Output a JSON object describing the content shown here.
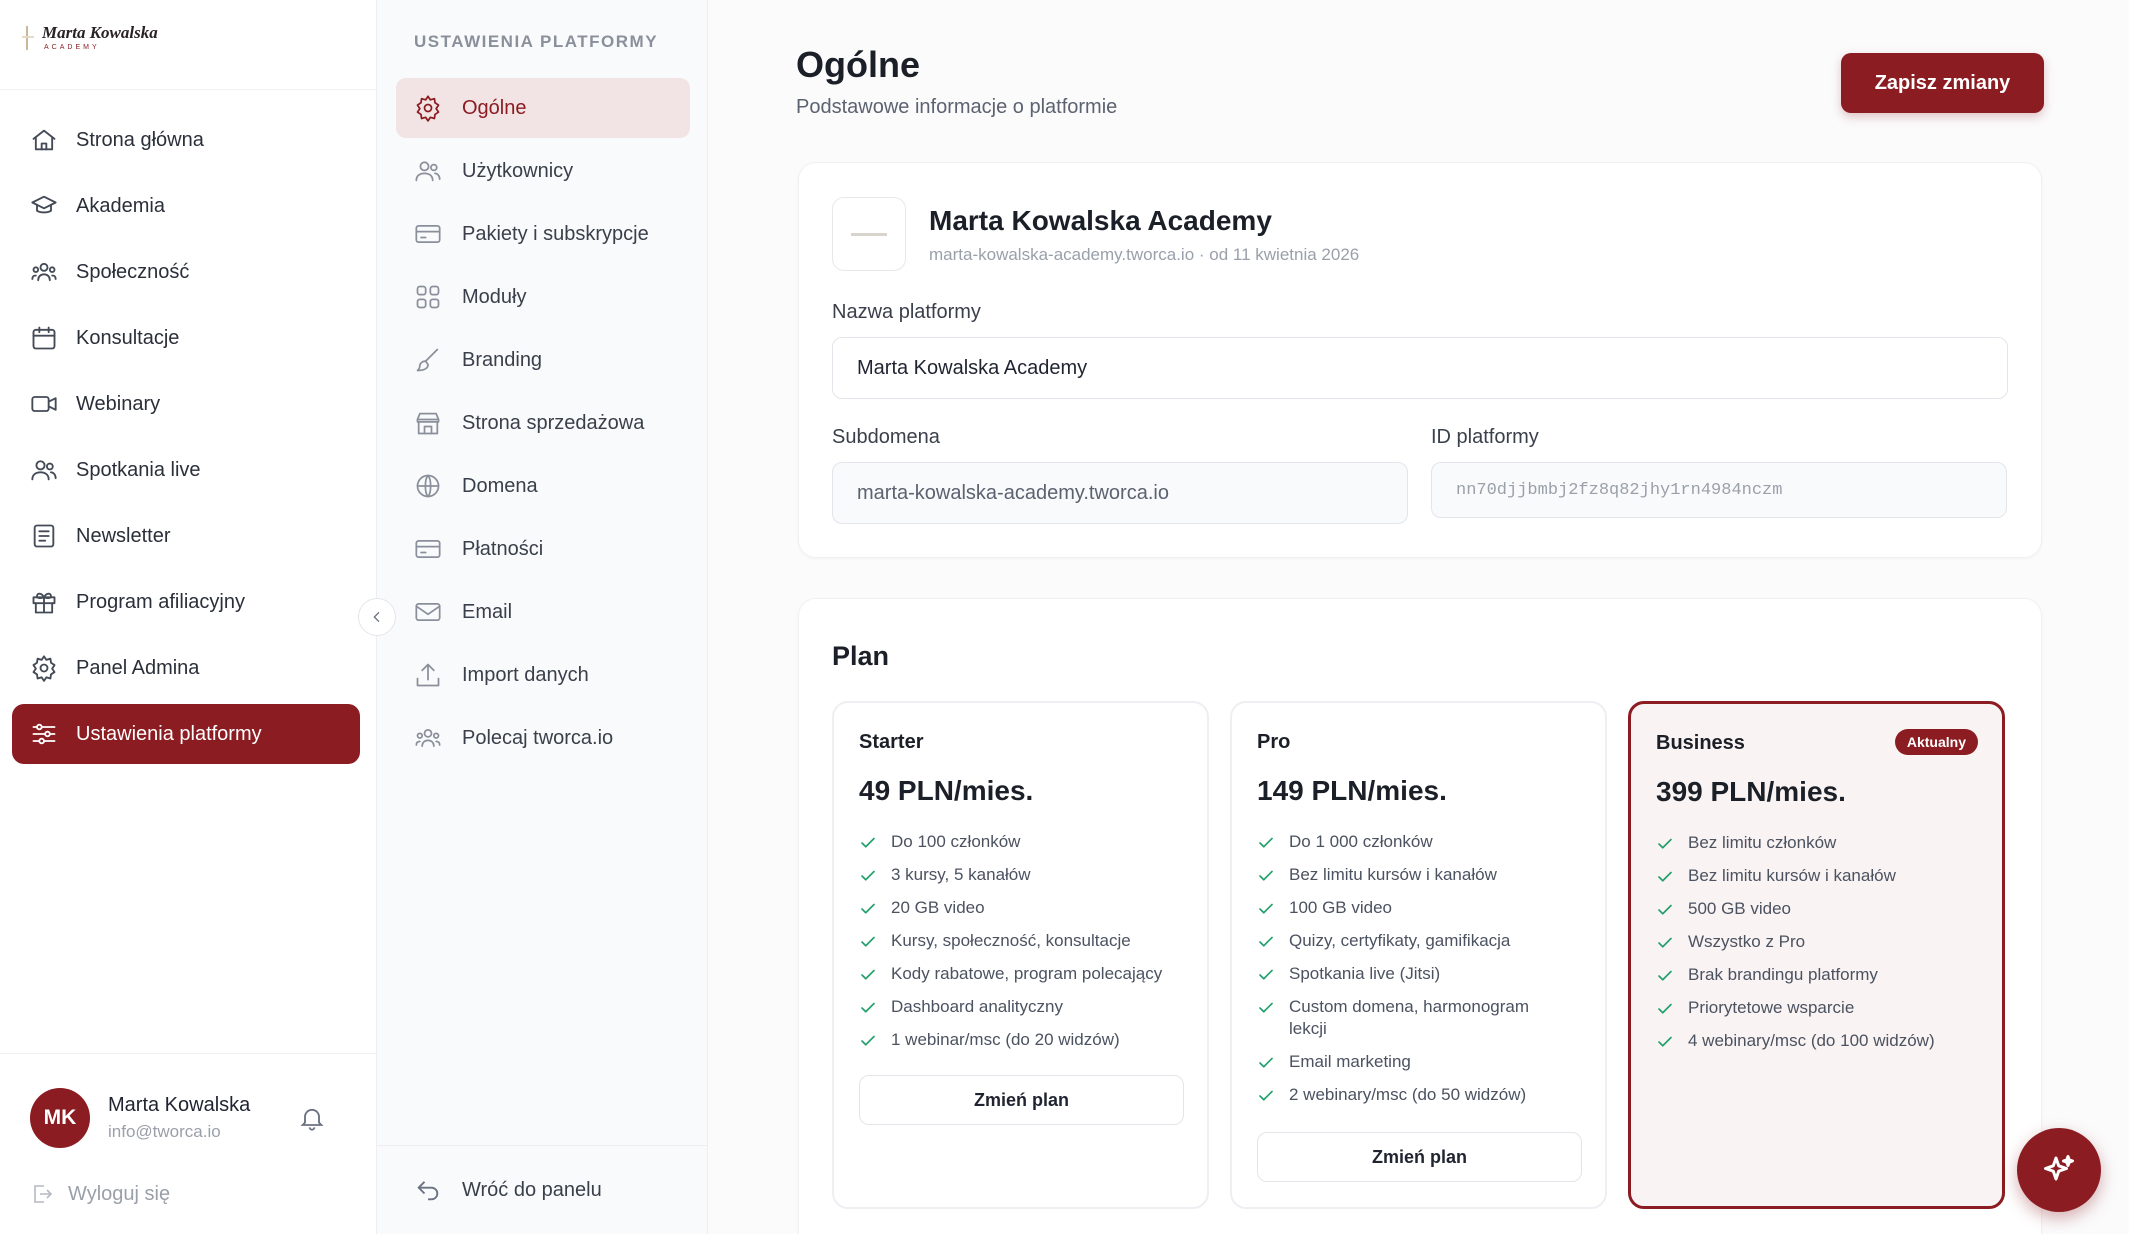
{
  "brand": {
    "name": "Marta Kowalska",
    "sub": "ACADEMY"
  },
  "sidebar": {
    "items": [
      {
        "label": "Strona główna",
        "icon": "home-icon"
      },
      {
        "label": "Akademia",
        "icon": "graduation-cap-icon"
      },
      {
        "label": "Społeczność",
        "icon": "community-icon"
      },
      {
        "label": "Konsultacje",
        "icon": "calendar-icon"
      },
      {
        "label": "Webinary",
        "icon": "video-icon"
      },
      {
        "label": "Spotkania live",
        "icon": "users-icon"
      },
      {
        "label": "Newsletter",
        "icon": "newsletter-icon"
      },
      {
        "label": "Program afiliacyjny",
        "icon": "gift-icon"
      },
      {
        "label": "Panel Admina",
        "icon": "gear-icon"
      },
      {
        "label": "Ustawienia platformy",
        "icon": "sliders-icon",
        "active": true
      }
    ]
  },
  "user": {
    "initials": "MK",
    "name": "Marta Kowalska",
    "email": "info@tworca.io",
    "logout": "Wyloguj się"
  },
  "settings_nav": {
    "title": "USTAWIENIA PLATFORMY",
    "items": [
      {
        "label": "Ogólne",
        "icon": "gear-icon",
        "active": true
      },
      {
        "label": "Użytkownicy",
        "icon": "users-icon"
      },
      {
        "label": "Pakiety i subskrypcje",
        "icon": "card-icon"
      },
      {
        "label": "Moduły",
        "icon": "grid-icon"
      },
      {
        "label": "Branding",
        "icon": "brush-icon"
      },
      {
        "label": "Strona sprzedażowa",
        "icon": "store-icon"
      },
      {
        "label": "Domena",
        "icon": "globe-icon"
      },
      {
        "label": "Płatności",
        "icon": "card-icon"
      },
      {
        "label": "Email",
        "icon": "mail-icon"
      },
      {
        "label": "Import danych",
        "icon": "upload-icon"
      },
      {
        "label": "Polecaj tworca.io",
        "icon": "community-icon"
      }
    ],
    "back": "Wróć do panelu"
  },
  "header": {
    "title": "Ogólne",
    "subtitle": "Podstawowe informacje o platformie",
    "save_label": "Zapisz zmiany"
  },
  "platform": {
    "name": "Marta Kowalska Academy",
    "meta": "marta-kowalska-academy.tworca.io · od 11 kwietnia 2026",
    "name_label": "Nazwa platformy",
    "name_value": "Marta Kowalska Academy",
    "subdomain_label": "Subdomena",
    "subdomain_value": "marta-kowalska-academy.tworca.io",
    "id_label": "ID platformy",
    "id_value": "nn70djjbmbj2fz8q82jhy1rn4984nczm"
  },
  "plans": {
    "title": "Plan",
    "current_badge": "Aktualny",
    "change_label": "Zmień plan",
    "items": [
      {
        "name": "Starter",
        "price": "49 PLN/mies.",
        "features": [
          "Do 100 członków",
          "3 kursy, 5 kanałów",
          "20 GB video",
          "Kursy, społeczność, konsultacje",
          "Kody rabatowe, program polecający",
          "Dashboard analityczny",
          "1 webinar/msc (do 20 widzów)"
        ]
      },
      {
        "name": "Pro",
        "price": "149 PLN/mies.",
        "features": [
          "Do 1 000 członków",
          "Bez limitu kursów i kanałów",
          "100 GB video",
          "Quizy, certyfikaty, gamifikacja",
          "Spotkania live (Jitsi)",
          "Custom domena, harmonogram lekcji",
          "Email marketing",
          "2 webinary/msc (do 50 widzów)"
        ]
      },
      {
        "name": "Business",
        "price": "399 PLN/mies.",
        "current": true,
        "features": [
          "Bez limitu członków",
          "Bez limitu kursów i kanałów",
          "500 GB video",
          "Wszystko z Pro",
          "Brak brandingu platformy",
          "Priorytetowe wsparcie",
          "4 webinary/msc (do 100 widzów)"
        ]
      }
    ]
  },
  "colors": {
    "accent": "#8b1c22",
    "accent_soft": "#f2e4e4",
    "check": "#22a06b"
  }
}
